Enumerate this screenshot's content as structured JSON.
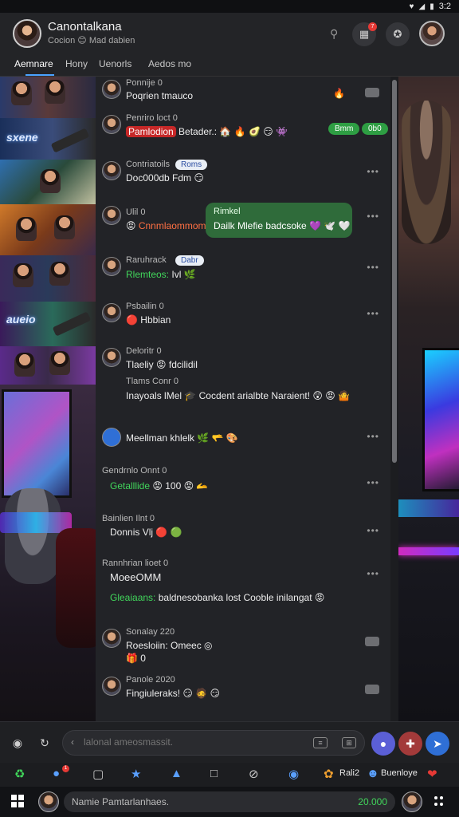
{
  "statusbar": {
    "time": "3:2",
    "icons": [
      "heart-icon",
      "signal-icon",
      "battery-icon"
    ]
  },
  "header": {
    "title": "Canontalkana",
    "subtitle": "Cocion 😊 Mad dabien",
    "notification_count": "7"
  },
  "tabs": [
    {
      "label": "Aemnare",
      "active": true
    },
    {
      "label": "Hony",
      "active": false
    },
    {
      "label": "Uenorls",
      "active": false
    },
    {
      "label": "Aedos mo",
      "active": false
    }
  ],
  "thumbnails": {
    "word1": "sxene",
    "word2": "aueio"
  },
  "messages": [
    {
      "name": "Ponnije 0",
      "text": "Poqrien tmauco",
      "icon": "fire-icon"
    },
    {
      "name": "Penriro loct 0",
      "tag": "Pamlodion",
      "text": "Betader.: 🏠 🔥 🥑 😏 👾",
      "pill1": "Bmm",
      "pill2": "0b0"
    },
    {
      "name": "Contriatoils",
      "pill": "Roms",
      "text": "Doc000db  Fdm  😏"
    },
    {
      "name": "Ulil 0",
      "text_red": "Cnnmlaommom",
      "bubble_title": "Rimkel",
      "bubble_text": "Dailk Mlefie badcsoke 💜 🕊️ 🤍"
    },
    {
      "name": "Raruhrack",
      "pill": "Dabr",
      "green_text": "Rlemteos:",
      "text": "Ivl 🌿"
    },
    {
      "name": "Psbailin 0",
      "text": "🔴 Hbbian"
    },
    {
      "name": "Deloritr 0",
      "text": "Tlaeliy 😡 fdcilidil",
      "sub_name": "Tlams Conr 0",
      "green_line": "Inayoals lMel 🎓 Cocdent arialbte Naraient! 😲 😡 🤷"
    },
    {
      "name": "",
      "text": "Meellman khlelk 🌿 🫳 🎨"
    },
    {
      "name": "Gendrnlo Onnt 0",
      "green_head": "Getalllide",
      "text": "😡 100 😡 🫴"
    },
    {
      "name": "Bainlien Ilnt 0",
      "text": "Donnis Vlj 🔴 🟢"
    },
    {
      "name": "Rannhrian lioet 0",
      "green_head": "MoeeOMM",
      "green_line": "Gleaiaans:",
      "text": "baldnesobanka lost Cooble inilangat 😡"
    },
    {
      "name": "Sonalay 220",
      "text": "Roesloiin: Omeec ◎",
      "sub": "🎁 0"
    },
    {
      "name": "Panole 2020",
      "text": "Fingiuleraks! 😏 🧔 😏"
    }
  ],
  "input": {
    "placeholder": "lalonal ameosmassit.",
    "mini1": "≡",
    "mini2": "⊞"
  },
  "iconrow": {
    "badge": "1",
    "label1": "Rali2",
    "label2": "Buenloye"
  },
  "taskbar": {
    "field_text": "Namie Pamtarlanhaes.",
    "field_number": "20.000"
  }
}
